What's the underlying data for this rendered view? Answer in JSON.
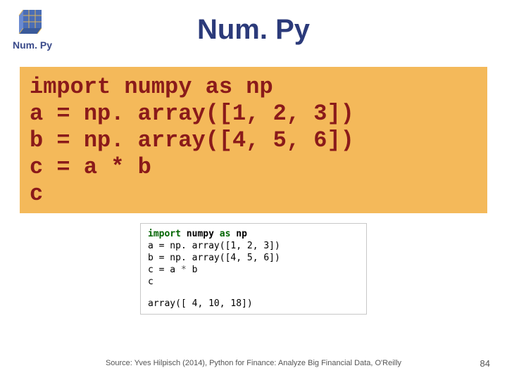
{
  "header": {
    "logo_label": "Num. Py",
    "title": "Num. Py"
  },
  "code": {
    "line1": "import numpy as np",
    "line2": "a = np. array([1, 2, 3])",
    "line3": "b = np. array([4, 5, 6])",
    "line4": "c = a * b",
    "line5": "c"
  },
  "output": {
    "kw_import": "import",
    "kw_as": "as",
    "mod_numpy": " numpy ",
    "mod_np": " np",
    "o2": "a = np. array([1, 2, 3])",
    "o3": "b = np. array([4, 5, 6])",
    "o4a": "c = a ",
    "o4star": "*",
    "o4b": " b",
    "o5": "c",
    "result": "array([ 4, 10, 18])"
  },
  "footer": {
    "source": "Source: Yves Hilpisch (2014), Python for Finance: Analyze Big Financial Data, O'Reilly",
    "page": "84"
  }
}
